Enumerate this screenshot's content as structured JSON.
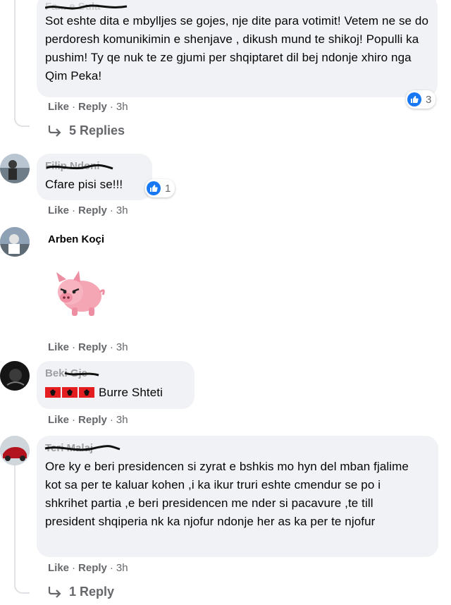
{
  "comments": [
    {
      "author": "Fa... e Sula",
      "text": "Sot eshte dita e mbylljes se gojes, nje dite para votimit! Vetem ne se do perdoresh komunikimin e shenjave , dikush mund te shikoj! Populli ka pushim! Ty qe nuk te ze gjumi per shqiptaret dil bej ndonje xhiro nga Qim Peka!",
      "like_label": "Like",
      "reply_label": "Reply",
      "time": "3h",
      "reactions": "3",
      "replies": "5 Replies"
    },
    {
      "author": "Filip Ndoni",
      "text": "Cfare pisi se!!!",
      "like_label": "Like",
      "reply_label": "Reply",
      "time": "3h",
      "reactions": "1"
    },
    {
      "author": "Arben Koçi",
      "sticker": "angry-pig-sticker",
      "like_label": "Like",
      "reply_label": "Reply",
      "time": "3h"
    },
    {
      "author": "Beki Gje",
      "text": "Burre Shteti",
      "flags": 3,
      "like_label": "Like",
      "reply_label": "Reply",
      "time": "3h"
    },
    {
      "author": "Teri Malaj",
      "text": "Ore ky e beri presidencen si zyrat e bshkis mo hyn del mban fjalime kot sa per te kaluar kohen ,i ka ikur truri eshte cmendur se po i shkrihet partia ,e beri presidencen me nder si pacavure ,te till president shqiperia nk ka njofur ndonje her as ka per te njofur",
      "like_label": "Like",
      "reply_label": "Reply",
      "time": "3h",
      "replies": "1 Reply"
    }
  ],
  "separator": "·",
  "colors": {
    "bubble": "#f0f2f5",
    "meta_text": "#65676b",
    "like_blue": "#1877f2"
  }
}
